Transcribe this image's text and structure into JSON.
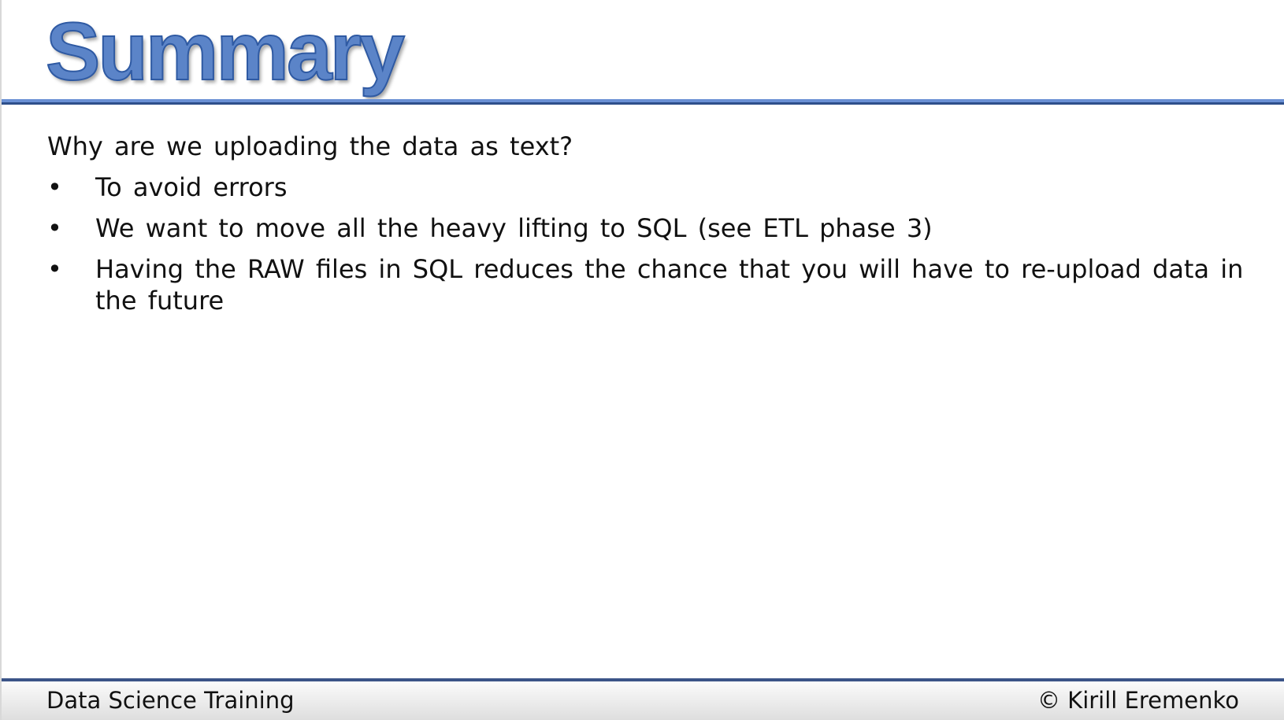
{
  "slide": {
    "title": "Summary",
    "question": "Why are we uploading the data as text?",
    "bullets": [
      "To avoid errors",
      "We want to move all the heavy lifting to SQL (see ETL phase 3)",
      "Having the RAW files in SQL reduces the chance that you will have to re-upload data in the future"
    ],
    "bullet_glyph": "•",
    "accent_color": "#5b84c8"
  },
  "footer": {
    "left": "Data Science Training",
    "right": "© Kirill Eremenko"
  }
}
